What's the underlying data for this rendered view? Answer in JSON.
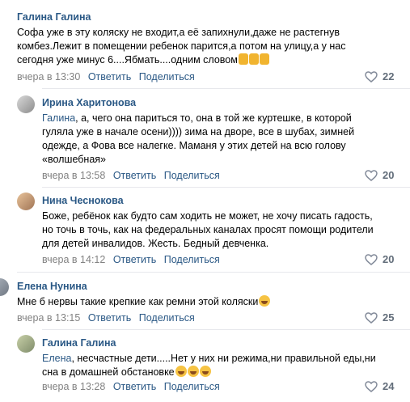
{
  "comments": [
    {
      "author": "Галина Галина",
      "lines": [
        "Софа уже в эту коляску не входит,а её запихнули,даже не растегнув",
        "комбез.Лежит в помещении ребенок парится,а потом на улицу,а у нас",
        "сегодня уже минус 6....Ябмать....одним словом"
      ],
      "date": "вчера в 13:30",
      "reply": "Ответить",
      "share": "Поделиться",
      "likes": "22"
    },
    {
      "author": "Ирина Харитонова",
      "mention": "Галина",
      "lines": [
        ", а, чего она париться то, она в той же куртешке, в которой",
        "гуляла уже в начале осени)))) зима на дворе, все в шубах, зимней",
        "одежде, а Фова все налегке. Маманя у этих детей на всю голову",
        "«волшебная»"
      ],
      "date": "вчера в 13:58",
      "reply": "Ответить",
      "share": "Поделиться",
      "likes": "20"
    },
    {
      "author": "Нина Чеснокова",
      "lines": [
        "Боже, ребёнок как будто сам ходить не может, не хочу писать гадость,",
        "но точь в точь, как на федеральных каналах просят помощи родители",
        "для детей инвалидов. Жесть. Бедный девченка."
      ],
      "date": "вчера в 14:12",
      "reply": "Ответить",
      "share": "Поделиться",
      "likes": "20"
    },
    {
      "author": "Елена Нунина",
      "lines": [
        "Мне б нервы такие крепкие как ремни этой коляски"
      ],
      "date": "вчера в 13:15",
      "reply": "Ответить",
      "share": "Поделиться",
      "likes": "25"
    },
    {
      "author": "Галина Галина",
      "mention": "Елена",
      "lines": [
        ", несчастные дети.....Нет у них ни режима,ни правильной еды,ни",
        "сна в домашней обстановке"
      ],
      "date": "вчера в 13:28",
      "reply": "Ответить",
      "share": "Поделиться",
      "likes": "24"
    }
  ],
  "colors": {
    "link": "#2a5885",
    "meta": "#828282",
    "likes": "#626d7a"
  },
  "icons": {
    "like": "heart-outline-icon",
    "dislike_emoji": "thumbs-down-emoji",
    "laugh_emoji": "rolling-laughing-emoji"
  }
}
